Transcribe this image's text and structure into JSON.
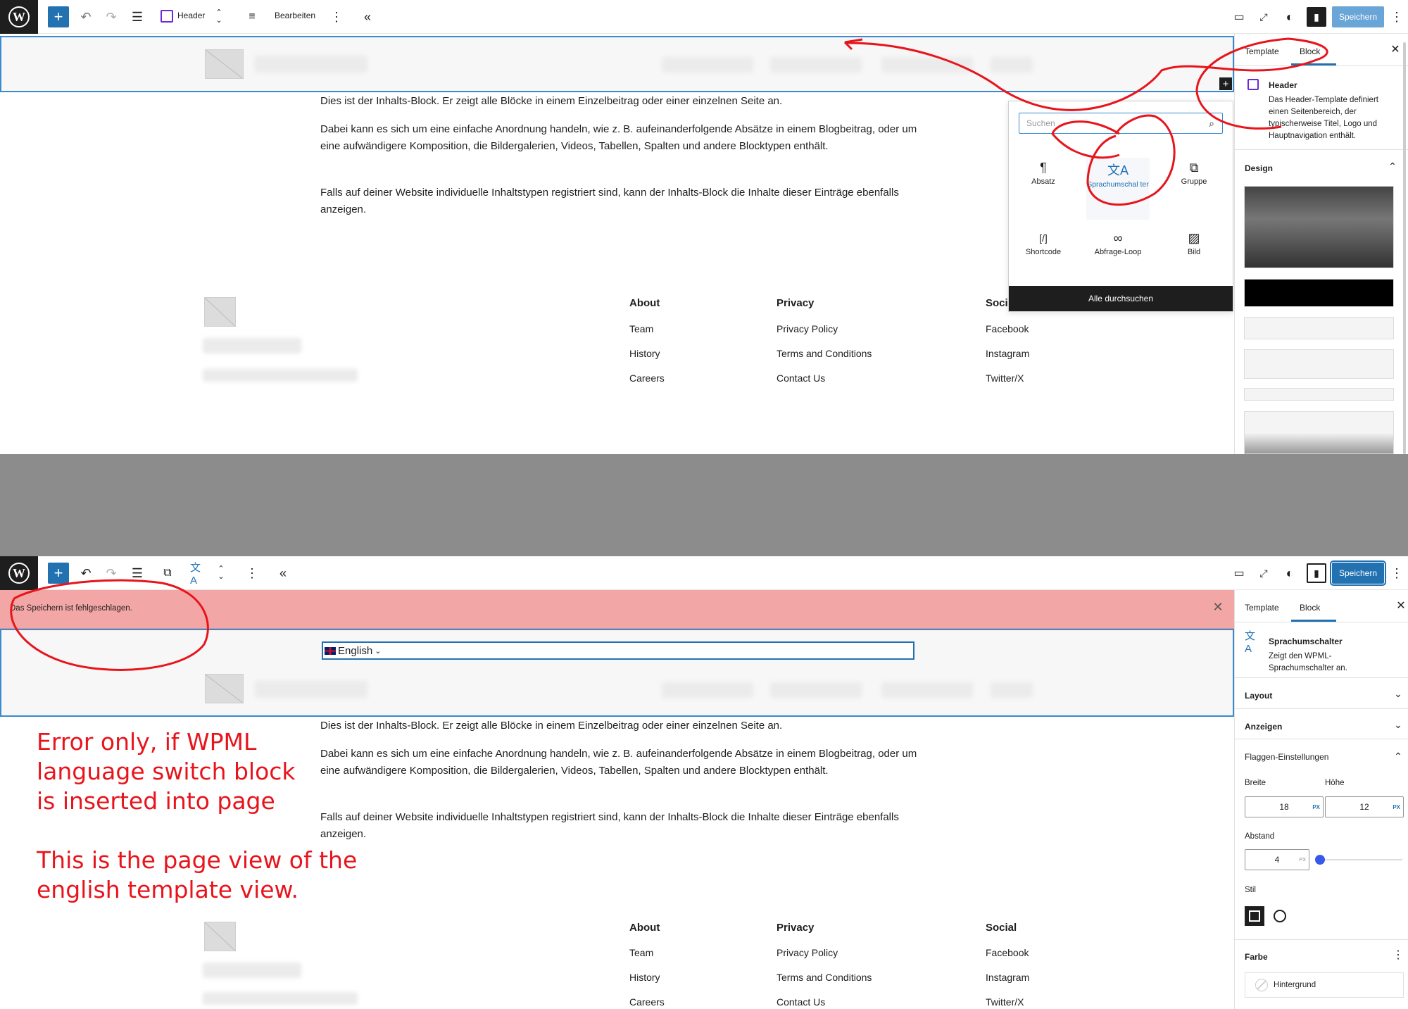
{
  "top": {
    "toolbar": {
      "template_label": "Header",
      "edit_label": "Bearbeiten",
      "save_label": "Speichern"
    },
    "content": {
      "p1": "Dies ist der Inhalts-Block. Er zeigt alle Blöcke in einem Einzelbeitrag oder einer einzelnen Seite an.",
      "p2": "Dabei kann es sich um eine einfache Anordnung handeln, wie z. B. aufeinanderfolgende Absätze in einem Blogbeitrag, oder um eine aufwändigere Komposition, die Bildergalerien, Videos, Tabellen, Spalten und andere Blocktypen enthält.",
      "p3": "Falls auf deiner Website individuelle Inhaltstypen registriert sind, kann der Inhalts-Block die Inhalte dieser Einträge ebenfalls anzeigen."
    },
    "footer": {
      "col1": {
        "heading": "About",
        "links": [
          "Team",
          "History",
          "Careers"
        ]
      },
      "col2": {
        "heading": "Privacy",
        "links": [
          "Privacy Policy",
          "Terms and Conditions",
          "Contact Us"
        ]
      },
      "col3": {
        "heading": "Soci",
        "links": [
          "Facebook",
          "Instagram",
          "Twitter/X"
        ]
      }
    },
    "inserter": {
      "search_placeholder": "Suchen",
      "items": [
        "Absatz",
        "Sprachumschal ter",
        "Gruppe",
        "Shortcode",
        "Abfrage-Loop",
        "Bild"
      ],
      "browse_all": "Alle durchsuchen"
    },
    "sidebar": {
      "tab_template": "Template",
      "tab_block": "Block",
      "block_title": "Header",
      "block_desc": "Das Header-Template definiert einen Seitenbereich, der typischerweise Titel, Logo und Hauptnavigation enthält.",
      "design_label": "Design"
    }
  },
  "bottom": {
    "toolbar": {
      "save_label": "Speichern"
    },
    "notice": "Das Speichern ist fehlgeschlagen.",
    "lang_switch": "English",
    "content": {
      "p1": "Dies ist der Inhalts-Block. Er zeigt alle Blöcke in einem Einzelbeitrag oder einer einzelnen Seite an.",
      "p2": "Dabei kann es sich um eine einfache Anordnung handeln, wie z. B. aufeinanderfolgende Absätze in einem Blogbeitrag, oder um eine aufwändigere Komposition, die Bildergalerien, Videos, Tabellen, Spalten und andere Blocktypen enthält.",
      "p3": "Falls auf deiner Website individuelle Inhaltstypen registriert sind, kann der Inhalts-Block die Inhalte dieser Einträge ebenfalls anzeigen."
    },
    "footer": {
      "col1": {
        "heading": "About",
        "links": [
          "Team",
          "History",
          "Careers"
        ]
      },
      "col2": {
        "heading": "Privacy",
        "links": [
          "Privacy Policy",
          "Terms and Conditions",
          "Contact Us"
        ]
      },
      "col3": {
        "heading": "Social",
        "links": [
          "Facebook",
          "Instagram",
          "Twitter/X"
        ]
      }
    },
    "annotation": {
      "line1": "Error only, if WPML",
      "line2": "language switch block",
      "line3": "is inserted into page",
      "line4": "This is the page view of the",
      "line5": "english template view."
    },
    "sidebar": {
      "tab_template": "Template",
      "tab_block": "Block",
      "block_title": "Sprachumschalter",
      "block_desc": "Zeigt den WPML-Sprachumschalter an.",
      "layout": "Layout",
      "anzeigen": "Anzeigen",
      "flags": "Flaggen-Einstellungen",
      "width_label": "Breite",
      "height_label": "Höhe",
      "width_value": "18",
      "height_value": "12",
      "unit": "PX",
      "spacing_label": "Abstand",
      "spacing_value": "4",
      "style_label": "Stil",
      "color_label": "Farbe",
      "background_label": "Hintergrund"
    }
  },
  "colors": {
    "accent": "#2271b1",
    "error_bg": "#f3a6a6",
    "annotation": "#e8141c"
  }
}
